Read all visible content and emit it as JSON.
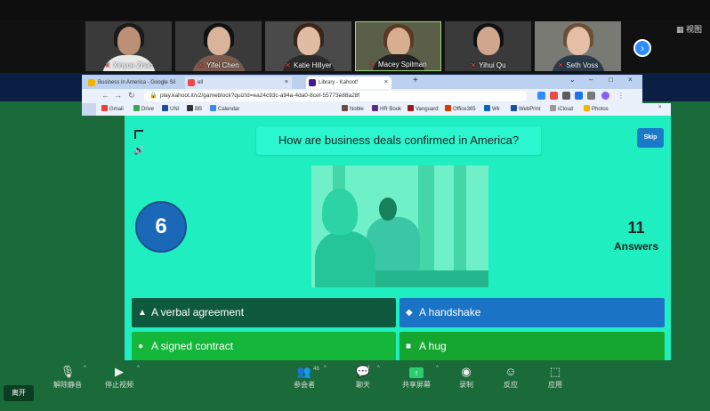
{
  "gallery": {
    "participants": [
      {
        "name": "Xinyue Zhao"
      },
      {
        "name": "Yifei Chen"
      },
      {
        "name": "Katie Hillyer"
      },
      {
        "name": "Macey Spilman"
      },
      {
        "name": "Yihui Qu"
      },
      {
        "name": "Seth Voss"
      }
    ],
    "view_label": "视图"
  },
  "browser": {
    "tabs": [
      {
        "title": "Business in America - Google Sli"
      },
      {
        "title": "ell"
      },
      {
        "title": "Library - Kahoot!"
      }
    ],
    "url": "play.kahoot.it/v2/gameblock?quizId=ea24c93c-a94a-4da0-8cef-55773e88a28f",
    "bookmarks": [
      {
        "label": "Gmail"
      },
      {
        "label": "Drive"
      },
      {
        "label": "UNI"
      },
      {
        "label": "BB"
      },
      {
        "label": "Calendar"
      },
      {
        "label": "Noble"
      },
      {
        "label": "HR Book"
      },
      {
        "label": "Vanguard"
      },
      {
        "label": "Office365"
      },
      {
        "label": "Wk"
      },
      {
        "label": "WebPrint"
      },
      {
        "label": "iCloud"
      },
      {
        "label": "Photos"
      }
    ]
  },
  "kahoot": {
    "question": "How are business deals confirmed in America?",
    "skip_label": "Skip",
    "timer": "6",
    "answers_count": "11",
    "answers_label": "Answers",
    "options": [
      {
        "symbol": "▲",
        "label": "A verbal agreement"
      },
      {
        "symbol": "◆",
        "label": "A handshake"
      },
      {
        "symbol": "●",
        "label": "A signed contract"
      },
      {
        "symbol": "■",
        "label": "A hug"
      }
    ]
  },
  "toolbar": {
    "leave": "离开",
    "mute": "解除静音",
    "stop_video": "停止视频",
    "participants": "参会者",
    "participants_count": "46",
    "chat": "聊天",
    "chat_count": "4",
    "share": "共享屏幕",
    "record": "录制",
    "reactions": "反应",
    "apps": "应用"
  }
}
